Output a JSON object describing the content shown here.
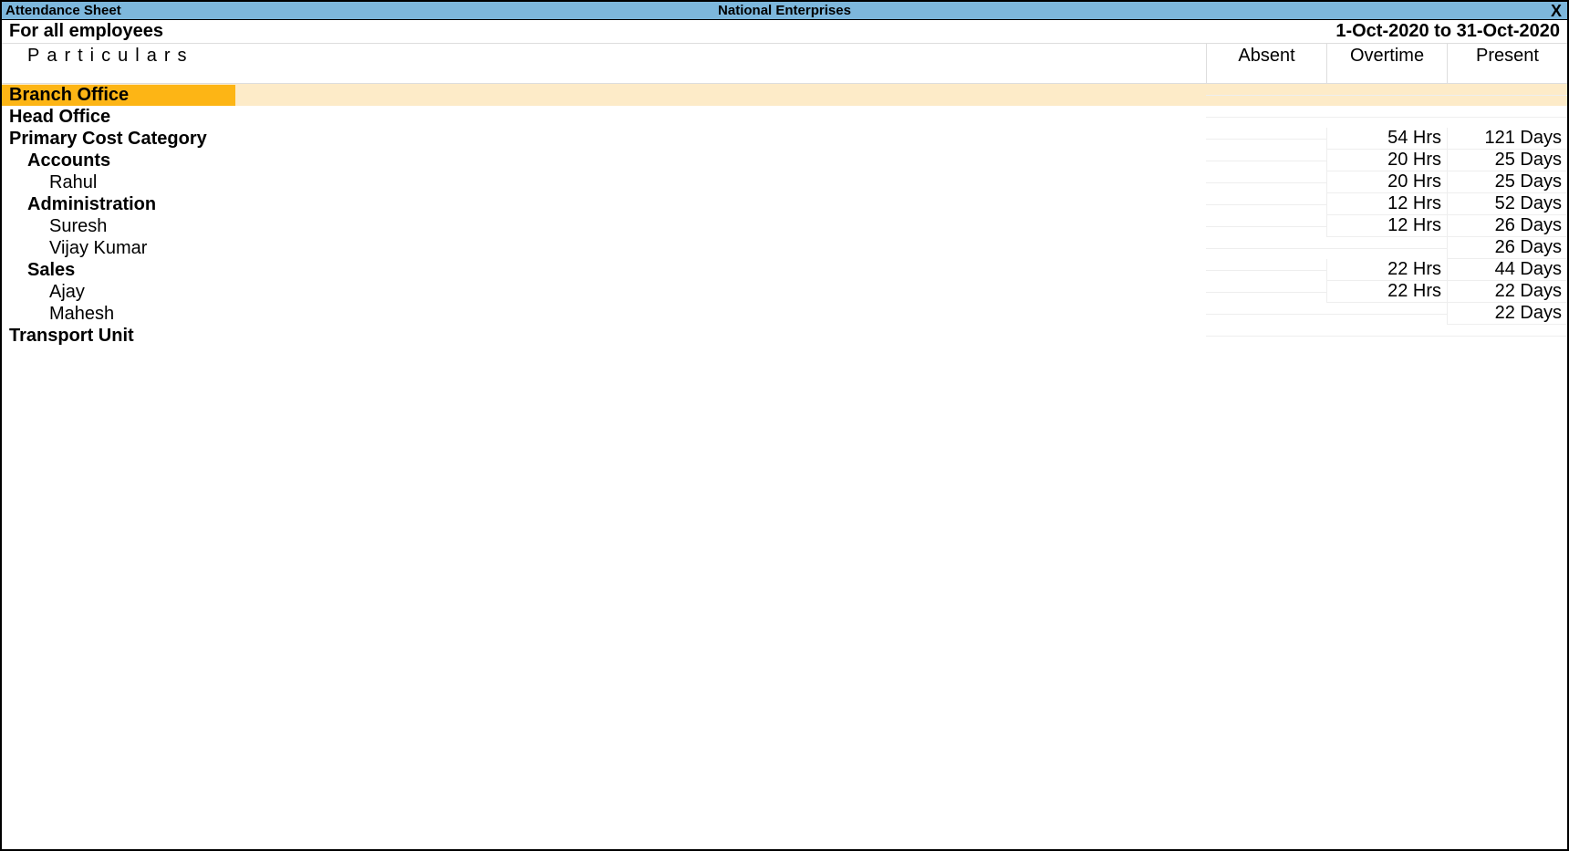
{
  "titlebar": {
    "left": "Attendance Sheet",
    "center": "National Enterprises",
    "close": "X"
  },
  "subheader": {
    "left": "For all employees",
    "right": "1-Oct-2020 to 31-Oct-2020"
  },
  "columns": {
    "particulars": "Particulars",
    "absent": "Absent",
    "overtime": "Overtime",
    "present": "Present"
  },
  "rows": {
    "branch_office": {
      "label": "Branch Office",
      "absent": "",
      "overtime": "",
      "present": ""
    },
    "head_office": {
      "label": "Head Office",
      "absent": "",
      "overtime": "",
      "present": ""
    },
    "primary_cost": {
      "label": "Primary Cost Category",
      "absent": "",
      "overtime": "54 Hrs",
      "present": "121 Days"
    },
    "accounts": {
      "label": "Accounts",
      "absent": "",
      "overtime": "20 Hrs",
      "present": "25 Days"
    },
    "rahul": {
      "label": "Rahul",
      "absent": "",
      "overtime": "20 Hrs",
      "present": "25 Days"
    },
    "administration": {
      "label": "Administration",
      "absent": "",
      "overtime": "12 Hrs",
      "present": "52 Days"
    },
    "suresh": {
      "label": "Suresh",
      "absent": "",
      "overtime": "12 Hrs",
      "present": "26 Days"
    },
    "vijay": {
      "label": "Vijay Kumar",
      "absent": "",
      "overtime": "",
      "present": "26 Days"
    },
    "sales": {
      "label": "Sales",
      "absent": "",
      "overtime": "22 Hrs",
      "present": "44 Days"
    },
    "ajay": {
      "label": "Ajay",
      "absent": "",
      "overtime": "22 Hrs",
      "present": "22 Days"
    },
    "mahesh": {
      "label": "Mahesh",
      "absent": "",
      "overtime": "",
      "present": "22 Days"
    },
    "transport": {
      "label": "Transport Unit",
      "absent": "",
      "overtime": "",
      "present": ""
    }
  }
}
